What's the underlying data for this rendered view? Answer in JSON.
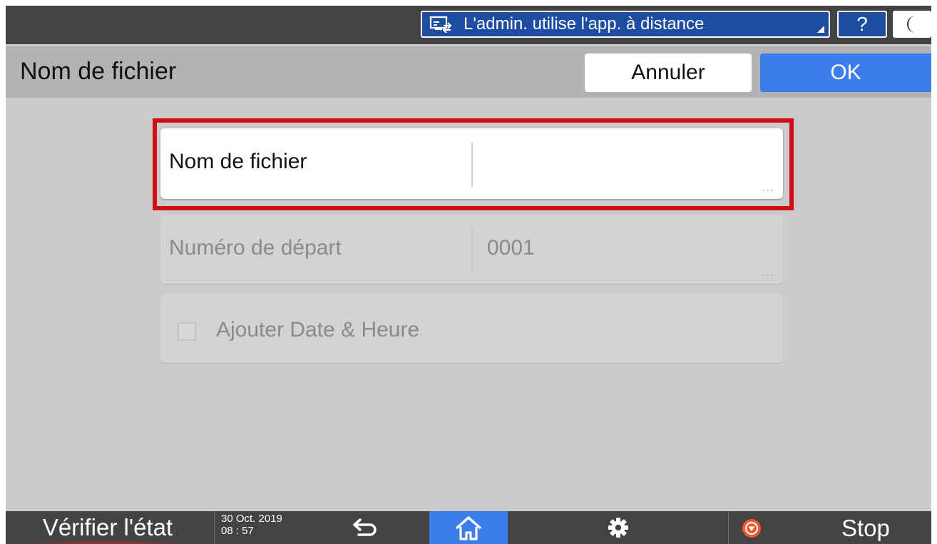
{
  "topbar": {
    "remote_banner_text": "L'admin. utilise l'app. à distance",
    "help_label": "?",
    "icons": [
      "remote-admin-icon",
      "moon-icon"
    ]
  },
  "header": {
    "title": "Nom de fichier",
    "cancel_label": "Annuler",
    "ok_label": "OK",
    "ok_color": "#3d7eea"
  },
  "form": {
    "file_name": {
      "label": "Nom de fichier",
      "value": "",
      "ellipsis": "..."
    },
    "start_number": {
      "label": "Numéro de départ",
      "value": "0001",
      "ellipsis": "..."
    },
    "add_datetime": {
      "label": "Ajouter Date & Heure",
      "checked": false
    },
    "highlight_color": "#d20d12"
  },
  "bottombar": {
    "status_label": "Vérifier l'état",
    "date": "30 Oct. 2019",
    "time": "08 : 57",
    "stop_label": "Stop",
    "icons": [
      "back-icon",
      "home-icon",
      "gear-icon",
      "stop-icon"
    ]
  }
}
